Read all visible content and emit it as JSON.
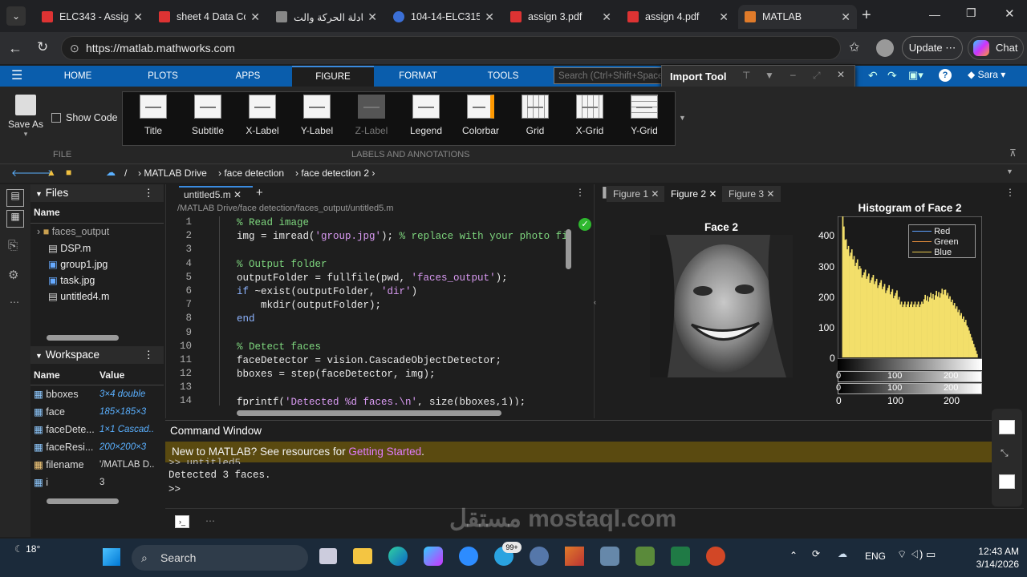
{
  "browser": {
    "tabs": [
      {
        "label": "ELC343 - Assignm",
        "color": "#d33"
      },
      {
        "label": "sheet 4 Data Con",
        "color": "#d33"
      },
      {
        "label": "معادلة الحركة والت",
        "color": "#888"
      },
      {
        "label": "104-14-ELC315-2",
        "color": "#3b6fd6"
      },
      {
        "label": "assign 3.pdf",
        "color": "#d33"
      },
      {
        "label": "assign 4.pdf",
        "color": "#d33"
      },
      {
        "label": "MATLAB",
        "color": "#e07b2a"
      }
    ],
    "url": "https://matlab.mathworks.com",
    "update_label": "Update",
    "chat_label": "Chat"
  },
  "matlab": {
    "tabs": [
      "HOME",
      "PLOTS",
      "APPS",
      "FIGURE",
      "FORMAT",
      "TOOLS"
    ],
    "search_placeholder": "Search (Ctrl+Shift+Space)",
    "import_tool": "Import Tool",
    "user": "Sara",
    "file_group": {
      "save_as": "Save As",
      "show_code": "Show Code",
      "label": "FILE"
    },
    "annotations": {
      "items": [
        "Title",
        "Subtitle",
        "X-Label",
        "Y-Label",
        "Z-Label",
        "Legend",
        "Colorbar",
        "Grid",
        "X-Grid",
        "Y-Grid"
      ],
      "label": "LABELS AND ANNOTATIONS"
    },
    "path": [
      "/",
      "MATLAB Drive",
      "face detection",
      "face detection 2"
    ]
  },
  "files": {
    "title": "Files",
    "col": "Name",
    "items": [
      "faces_output",
      "DSP.m",
      "group1.jpg",
      "task.jpg",
      "untitled4.m"
    ]
  },
  "workspace": {
    "title": "Workspace",
    "col_name": "Name",
    "col_value": "Value",
    "rows": [
      {
        "name": "bboxes",
        "value": "3×4 double"
      },
      {
        "name": "face",
        "value": "185×185×3"
      },
      {
        "name": "faceDete...",
        "value": "1×1 Cascad..."
      },
      {
        "name": "faceResi...",
        "value": "200×200×3"
      },
      {
        "name": "filename",
        "value": "'/MATLAB D..."
      },
      {
        "name": "i",
        "value": "3"
      }
    ]
  },
  "editor": {
    "tab": "untitled5.m",
    "path": "/MATLAB Drive/face detection/faces_output/untitled5.m",
    "lines": [
      "1",
      "2",
      "3",
      "4",
      "5",
      "6",
      "7",
      "8",
      "9",
      "10",
      "11",
      "12",
      "13",
      "14"
    ]
  },
  "figures": {
    "tabs": [
      "Figure 1",
      "Figure 2",
      "Figure 3"
    ],
    "face_title": "Face 2",
    "hist_title": "Histogram of Face 2",
    "legend": [
      "Red",
      "Green",
      "Blue"
    ],
    "yticks": [
      "400",
      "300",
      "200",
      "100",
      "0"
    ],
    "xticks": [
      "0",
      "100",
      "200"
    ]
  },
  "command": {
    "title": "Command Window",
    "banner_text": "New to MATLAB? See resources for ",
    "banner_link": "Getting Started",
    "banner_end": ".",
    "prev": ">> untitled5",
    "output": "Detected 3 faces.",
    "prompt": ">>"
  },
  "taskbar": {
    "temp": "18°",
    "search": "Search",
    "badge": "99+",
    "lang": "ENG",
    "time": "12:43 AM",
    "date": "3/14/2026"
  },
  "watermark": "مستقل mostaql.com"
}
